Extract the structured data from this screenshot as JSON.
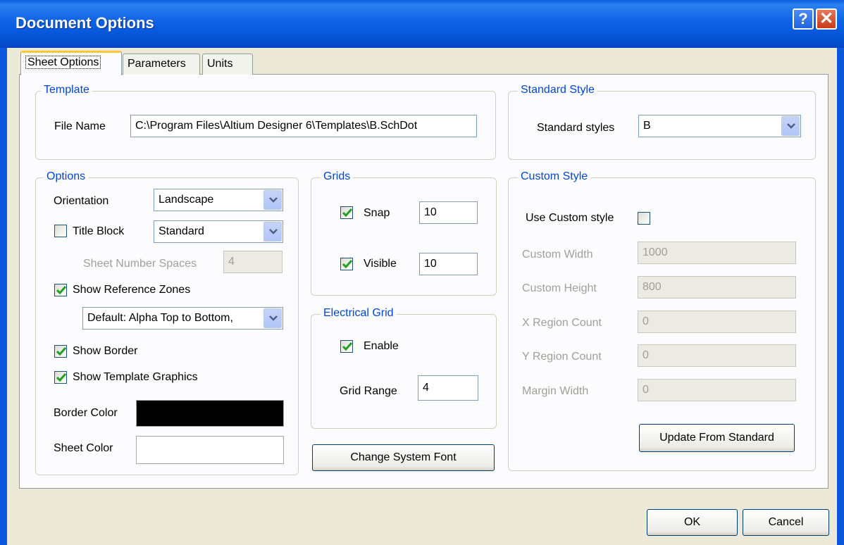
{
  "window": {
    "title": "Document Options"
  },
  "title_buttons": {
    "help": "?",
    "close": "✕"
  },
  "tabs": [
    {
      "label": "Sheet Options",
      "active": true
    },
    {
      "label": "Parameters",
      "active": false
    },
    {
      "label": "Units",
      "active": false
    }
  ],
  "template": {
    "legend": "Template",
    "file_name_label": "File Name",
    "file_name_value": "C:\\Program Files\\Altium Designer 6\\Templates\\B.SchDot"
  },
  "standard_style": {
    "legend": "Standard Style",
    "label": "Standard styles",
    "value": "B"
  },
  "options": {
    "legend": "Options",
    "orientation_label": "Orientation",
    "orientation_value": "Landscape",
    "title_block_label": "Title Block",
    "title_block_checked": false,
    "title_block_value": "Standard",
    "sheet_number_spaces_label": "Sheet Number Spaces",
    "sheet_number_spaces_value": "4",
    "show_reference_zones_label": "Show Reference Zones",
    "show_reference_zones_checked": true,
    "reference_zones_value": "Default: Alpha Top to Bottom,",
    "show_border_label": "Show Border",
    "show_border_checked": true,
    "show_template_graphics_label": "Show Template Graphics",
    "show_template_graphics_checked": true,
    "border_color_label": "Border Color",
    "border_color": "#000000",
    "sheet_color_label": "Sheet Color",
    "sheet_color": "#ffffff"
  },
  "grids": {
    "legend": "Grids",
    "snap_label": "Snap",
    "snap_checked": true,
    "snap_value": "10",
    "visible_label": "Visible",
    "visible_checked": true,
    "visible_value": "10"
  },
  "electrical_grid": {
    "legend": "Electrical Grid",
    "enable_label": "Enable",
    "enable_checked": true,
    "grid_range_label": "Grid Range",
    "grid_range_value": "4"
  },
  "change_font_button": "Change System Font",
  "custom_style": {
    "legend": "Custom Style",
    "use_custom_label": "Use Custom style",
    "use_custom_checked": false,
    "custom_width_label": "Custom Width",
    "custom_width_value": "1000",
    "custom_height_label": "Custom Height",
    "custom_height_value": "800",
    "x_region_label": "X Region Count",
    "x_region_value": "0",
    "y_region_label": "Y Region Count",
    "y_region_value": "0",
    "margin_width_label": "Margin Width",
    "margin_width_value": "0",
    "update_button": "Update From Standard"
  },
  "footer": {
    "ok": "OK",
    "cancel": "Cancel"
  },
  "icons": {
    "checkmark": "check-icon",
    "dropdown": "chevron-down-icon",
    "help": "help-icon",
    "close": "close-icon"
  },
  "colors": {
    "titlebar": "#0553d6",
    "legend_text": "#0046d5",
    "disabled_text": "#a19f96",
    "check": "#21a121"
  }
}
